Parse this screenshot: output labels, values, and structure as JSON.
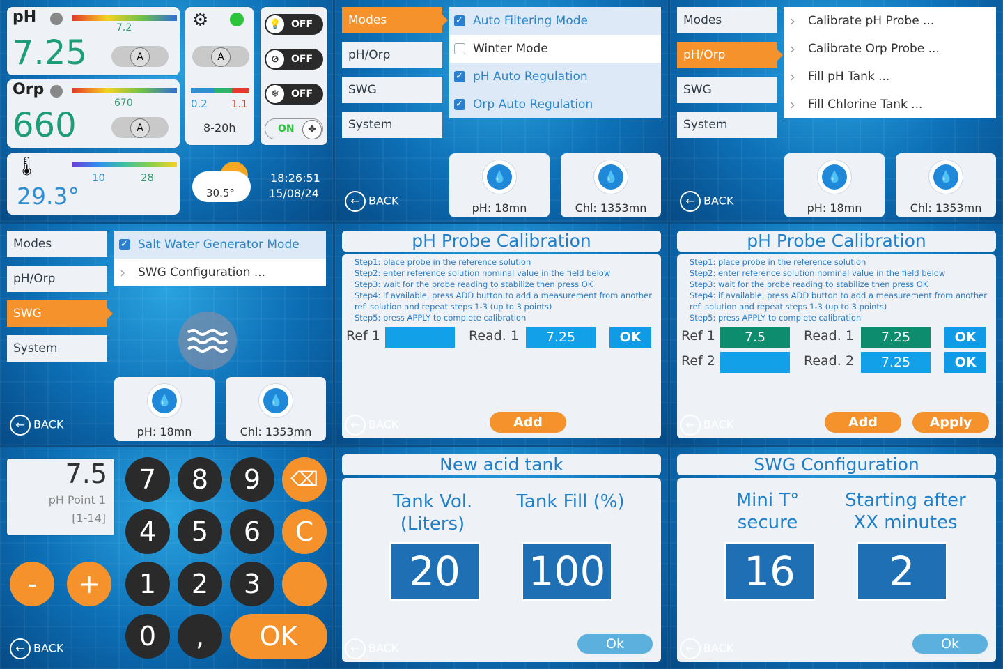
{
  "dashboard": {
    "ph": {
      "label": "pH",
      "value": "7.25",
      "target": "7.2",
      "mode": "A"
    },
    "orp": {
      "label": "Orp",
      "value": "660",
      "target": "670",
      "mode": "A"
    },
    "temp": {
      "value": "29.3°",
      "min": "10",
      "max": "28"
    },
    "pump": {
      "mode": "A",
      "min": "0.2",
      "max": "1.1",
      "schedule": "8-20h"
    },
    "toggles": [
      "OFF",
      "OFF",
      "OFF",
      "ON"
    ],
    "weather": {
      "temp": "30.5°"
    },
    "clock": {
      "time": "18:26:51",
      "date": "15/08/24"
    }
  },
  "menu": {
    "modes": "Modes",
    "ph_orp": "pH/Orp",
    "swg": "SWG",
    "system": "System"
  },
  "modes_panel": {
    "options": [
      {
        "label": "Auto Filtering Mode",
        "checked": true
      },
      {
        "label": "Winter Mode",
        "checked": false
      },
      {
        "label": "pH Auto Regulation",
        "checked": true
      },
      {
        "label": "Orp Auto Regulation",
        "checked": true
      }
    ]
  },
  "phorp_panel": {
    "options": [
      "Calibrate pH Probe ...",
      "Calibrate Orp Probe ...",
      "Fill pH Tank ...",
      "Fill Chlorine Tank ..."
    ]
  },
  "swg_panel": {
    "option_check": "Salt Water Generator Mode",
    "option_link": "SWG Configuration ..."
  },
  "timers": {
    "ph": "pH: 18mn",
    "chl": "Chl: 1353mn"
  },
  "back_label": "BACK",
  "calibration": {
    "title": "pH Probe Calibration",
    "steps": [
      "Step1: place probe in the reference solution",
      "Step2: enter reference solution nominal value in the field below",
      "Step3: wait for the probe reading to stabilize then press OK",
      "Step4: if available, press ADD button to add a measurement from another",
      "ref. solution and repeat steps 1-3 (up to 3 points)",
      "Step5: press APPLY to complete calibration"
    ],
    "ref1_label": "Ref 1",
    "ref2_label": "Ref 2",
    "read1_label": "Read. 1",
    "read2_label": "Read. 2",
    "ref1_value": "7.5",
    "read_value": "7.25",
    "ok": "OK",
    "add": "Add",
    "apply": "Apply"
  },
  "keypad": {
    "display_value": "7.5",
    "display_label": "pH Point 1",
    "display_range": "[1-14]",
    "keys": [
      "7",
      "8",
      "9",
      "4",
      "5",
      "6",
      "1",
      "2",
      "3",
      "0",
      ","
    ],
    "clear": "C",
    "minus": "-",
    "plus": "+",
    "ok": "OK"
  },
  "acid_tank": {
    "title": "New acid tank",
    "vol_label": "Tank Vol.\n(Liters)",
    "fill_label": "Tank Fill (%)",
    "vol": "20",
    "fill": "100",
    "ok": "Ok"
  },
  "swg_config": {
    "title": "SWG Configuration",
    "mini_label": "Mini T°\nsecure",
    "start_label": "Starting after\nXX minutes",
    "mini": "16",
    "start": "2",
    "ok": "Ok"
  }
}
